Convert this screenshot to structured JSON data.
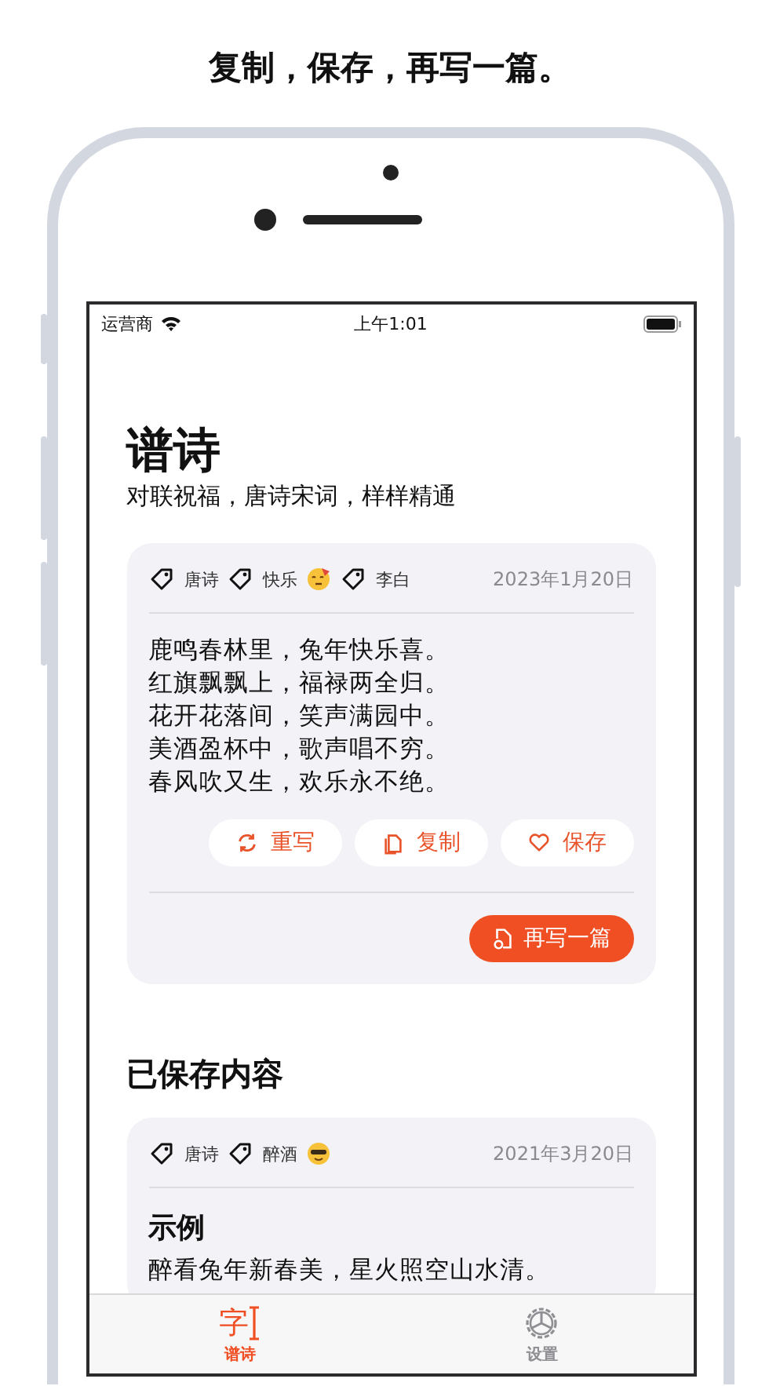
{
  "headline": "复制，保存，再写一篇。",
  "status_bar": {
    "carrier": "运营商",
    "time": "上午1:01"
  },
  "header": {
    "title": "谱诗",
    "subtitle": "对联祝福，唐诗宋词，样样精通"
  },
  "current_poem": {
    "tags": [
      {
        "label": "唐诗"
      },
      {
        "label": "快乐",
        "kind": "party"
      },
      {
        "label": "李白"
      }
    ],
    "date": "2023年1月20日",
    "lines": [
      "鹿鸣春林里，兔年快乐喜。",
      "红旗飘飘上，福禄两全归。",
      "花开花落间，笑声满园中。",
      "美酒盈杯中，歌声唱不穷。",
      "春风吹又生，欢乐永不绝。"
    ],
    "actions": [
      {
        "kind": "rewrite",
        "label": "重写"
      },
      {
        "kind": "copy",
        "label": "复制"
      },
      {
        "kind": "save",
        "label": "保存"
      }
    ],
    "primary_action": {
      "label": "再写一篇"
    }
  },
  "saved_section": {
    "title": "已保存内容",
    "items": [
      {
        "tags": [
          {
            "label": "唐诗"
          },
          {
            "label": "醉酒",
            "kind": "cool"
          }
        ],
        "date": "2021年3月20日",
        "title": "示例",
        "lines": [
          "醉看兔年新春美，星火照空山水清。"
        ]
      }
    ]
  },
  "tab_bar": [
    {
      "kind": "poem",
      "glyph": "字",
      "label": "谱诗",
      "selected": true
    },
    {
      "kind": "settings",
      "label": "设置",
      "selected": false
    }
  ]
}
